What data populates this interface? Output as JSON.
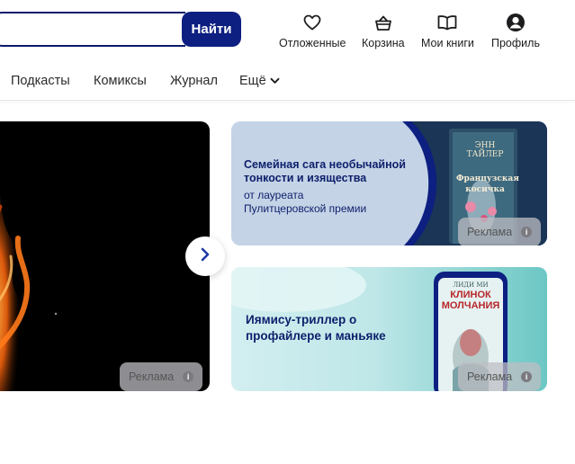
{
  "header": {
    "search_button": "Найти",
    "links": [
      {
        "icon": "heart-icon",
        "label": "Отложенные"
      },
      {
        "icon": "basket-icon",
        "label": "Корзина"
      },
      {
        "icon": "book-icon",
        "label": "Мои книги"
      },
      {
        "icon": "profile-icon",
        "label": "Профиль"
      }
    ]
  },
  "nav": {
    "items": [
      "Подкасты",
      "Комиксы",
      "Журнал"
    ],
    "more_label": "Ещё"
  },
  "hero": {
    "ad_label": "Реклама"
  },
  "banners": [
    {
      "title": "Семейная сага необычайной тонкости и изящества",
      "subtitle_line1": "от лауреата",
      "subtitle_line2": "Пулитцеровской премии",
      "book_author": "ЭНН ТАЙЛЕР",
      "book_title_line1": "Французская",
      "book_title_line2": "косичка",
      "ad_label": "Реклама"
    },
    {
      "title": "Иямису-триллер о профайлере и маньяке",
      "book_author": "ЛИДИ МИ",
      "book_title_line1": "КЛИНОК",
      "book_title_line2": "МОЛЧАНИЯ",
      "ad_label": "Реклама"
    }
  ],
  "colors": {
    "brand": "#0d1f80",
    "banner1_bg": "#c4d3e6",
    "banner2_bg": "#bfe7e8"
  }
}
